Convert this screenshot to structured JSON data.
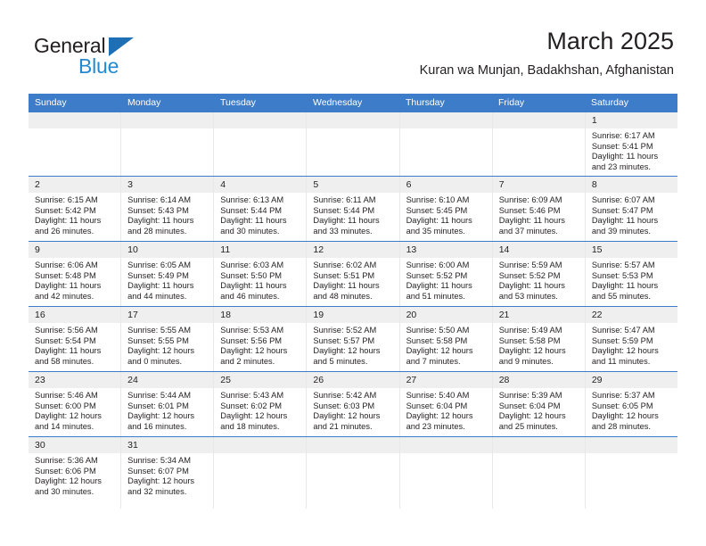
{
  "brand": {
    "name_top": "General",
    "name_bottom": "Blue",
    "accent_color": "#2389d1",
    "triangle_color": "#1f6fb5"
  },
  "header": {
    "month_title": "March 2025",
    "location": "Kuran wa Munjan, Badakhshan, Afghanistan"
  },
  "theme": {
    "header_blue": "#3d7cc9",
    "daynum_band": "#efefef",
    "text": "#231f20"
  },
  "weekdays": [
    "Sunday",
    "Monday",
    "Tuesday",
    "Wednesday",
    "Thursday",
    "Friday",
    "Saturday"
  ],
  "weeks": [
    {
      "days": [
        {
          "blank": true
        },
        {
          "blank": true
        },
        {
          "blank": true
        },
        {
          "blank": true
        },
        {
          "blank": true
        },
        {
          "blank": true
        },
        {
          "num": "1",
          "sunrise": "Sunrise: 6:17 AM",
          "sunset": "Sunset: 5:41 PM",
          "daylight_l1": "Daylight: 11 hours",
          "daylight_l2": "and 23 minutes."
        }
      ]
    },
    {
      "days": [
        {
          "num": "2",
          "sunrise": "Sunrise: 6:15 AM",
          "sunset": "Sunset: 5:42 PM",
          "daylight_l1": "Daylight: 11 hours",
          "daylight_l2": "and 26 minutes."
        },
        {
          "num": "3",
          "sunrise": "Sunrise: 6:14 AM",
          "sunset": "Sunset: 5:43 PM",
          "daylight_l1": "Daylight: 11 hours",
          "daylight_l2": "and 28 minutes."
        },
        {
          "num": "4",
          "sunrise": "Sunrise: 6:13 AM",
          "sunset": "Sunset: 5:44 PM",
          "daylight_l1": "Daylight: 11 hours",
          "daylight_l2": "and 30 minutes."
        },
        {
          "num": "5",
          "sunrise": "Sunrise: 6:11 AM",
          "sunset": "Sunset: 5:44 PM",
          "daylight_l1": "Daylight: 11 hours",
          "daylight_l2": "and 33 minutes."
        },
        {
          "num": "6",
          "sunrise": "Sunrise: 6:10 AM",
          "sunset": "Sunset: 5:45 PM",
          "daylight_l1": "Daylight: 11 hours",
          "daylight_l2": "and 35 minutes."
        },
        {
          "num": "7",
          "sunrise": "Sunrise: 6:09 AM",
          "sunset": "Sunset: 5:46 PM",
          "daylight_l1": "Daylight: 11 hours",
          "daylight_l2": "and 37 minutes."
        },
        {
          "num": "8",
          "sunrise": "Sunrise: 6:07 AM",
          "sunset": "Sunset: 5:47 PM",
          "daylight_l1": "Daylight: 11 hours",
          "daylight_l2": "and 39 minutes."
        }
      ]
    },
    {
      "days": [
        {
          "num": "9",
          "sunrise": "Sunrise: 6:06 AM",
          "sunset": "Sunset: 5:48 PM",
          "daylight_l1": "Daylight: 11 hours",
          "daylight_l2": "and 42 minutes."
        },
        {
          "num": "10",
          "sunrise": "Sunrise: 6:05 AM",
          "sunset": "Sunset: 5:49 PM",
          "daylight_l1": "Daylight: 11 hours",
          "daylight_l2": "and 44 minutes."
        },
        {
          "num": "11",
          "sunrise": "Sunrise: 6:03 AM",
          "sunset": "Sunset: 5:50 PM",
          "daylight_l1": "Daylight: 11 hours",
          "daylight_l2": "and 46 minutes."
        },
        {
          "num": "12",
          "sunrise": "Sunrise: 6:02 AM",
          "sunset": "Sunset: 5:51 PM",
          "daylight_l1": "Daylight: 11 hours",
          "daylight_l2": "and 48 minutes."
        },
        {
          "num": "13",
          "sunrise": "Sunrise: 6:00 AM",
          "sunset": "Sunset: 5:52 PM",
          "daylight_l1": "Daylight: 11 hours",
          "daylight_l2": "and 51 minutes."
        },
        {
          "num": "14",
          "sunrise": "Sunrise: 5:59 AM",
          "sunset": "Sunset: 5:52 PM",
          "daylight_l1": "Daylight: 11 hours",
          "daylight_l2": "and 53 minutes."
        },
        {
          "num": "15",
          "sunrise": "Sunrise: 5:57 AM",
          "sunset": "Sunset: 5:53 PM",
          "daylight_l1": "Daylight: 11 hours",
          "daylight_l2": "and 55 minutes."
        }
      ]
    },
    {
      "days": [
        {
          "num": "16",
          "sunrise": "Sunrise: 5:56 AM",
          "sunset": "Sunset: 5:54 PM",
          "daylight_l1": "Daylight: 11 hours",
          "daylight_l2": "and 58 minutes."
        },
        {
          "num": "17",
          "sunrise": "Sunrise: 5:55 AM",
          "sunset": "Sunset: 5:55 PM",
          "daylight_l1": "Daylight: 12 hours",
          "daylight_l2": "and 0 minutes."
        },
        {
          "num": "18",
          "sunrise": "Sunrise: 5:53 AM",
          "sunset": "Sunset: 5:56 PM",
          "daylight_l1": "Daylight: 12 hours",
          "daylight_l2": "and 2 minutes."
        },
        {
          "num": "19",
          "sunrise": "Sunrise: 5:52 AM",
          "sunset": "Sunset: 5:57 PM",
          "daylight_l1": "Daylight: 12 hours",
          "daylight_l2": "and 5 minutes."
        },
        {
          "num": "20",
          "sunrise": "Sunrise: 5:50 AM",
          "sunset": "Sunset: 5:58 PM",
          "daylight_l1": "Daylight: 12 hours",
          "daylight_l2": "and 7 minutes."
        },
        {
          "num": "21",
          "sunrise": "Sunrise: 5:49 AM",
          "sunset": "Sunset: 5:58 PM",
          "daylight_l1": "Daylight: 12 hours",
          "daylight_l2": "and 9 minutes."
        },
        {
          "num": "22",
          "sunrise": "Sunrise: 5:47 AM",
          "sunset": "Sunset: 5:59 PM",
          "daylight_l1": "Daylight: 12 hours",
          "daylight_l2": "and 11 minutes."
        }
      ]
    },
    {
      "days": [
        {
          "num": "23",
          "sunrise": "Sunrise: 5:46 AM",
          "sunset": "Sunset: 6:00 PM",
          "daylight_l1": "Daylight: 12 hours",
          "daylight_l2": "and 14 minutes."
        },
        {
          "num": "24",
          "sunrise": "Sunrise: 5:44 AM",
          "sunset": "Sunset: 6:01 PM",
          "daylight_l1": "Daylight: 12 hours",
          "daylight_l2": "and 16 minutes."
        },
        {
          "num": "25",
          "sunrise": "Sunrise: 5:43 AM",
          "sunset": "Sunset: 6:02 PM",
          "daylight_l1": "Daylight: 12 hours",
          "daylight_l2": "and 18 minutes."
        },
        {
          "num": "26",
          "sunrise": "Sunrise: 5:42 AM",
          "sunset": "Sunset: 6:03 PM",
          "daylight_l1": "Daylight: 12 hours",
          "daylight_l2": "and 21 minutes."
        },
        {
          "num": "27",
          "sunrise": "Sunrise: 5:40 AM",
          "sunset": "Sunset: 6:04 PM",
          "daylight_l1": "Daylight: 12 hours",
          "daylight_l2": "and 23 minutes."
        },
        {
          "num": "28",
          "sunrise": "Sunrise: 5:39 AM",
          "sunset": "Sunset: 6:04 PM",
          "daylight_l1": "Daylight: 12 hours",
          "daylight_l2": "and 25 minutes."
        },
        {
          "num": "29",
          "sunrise": "Sunrise: 5:37 AM",
          "sunset": "Sunset: 6:05 PM",
          "daylight_l1": "Daylight: 12 hours",
          "daylight_l2": "and 28 minutes."
        }
      ]
    },
    {
      "days": [
        {
          "num": "30",
          "sunrise": "Sunrise: 5:36 AM",
          "sunset": "Sunset: 6:06 PM",
          "daylight_l1": "Daylight: 12 hours",
          "daylight_l2": "and 30 minutes."
        },
        {
          "num": "31",
          "sunrise": "Sunrise: 5:34 AM",
          "sunset": "Sunset: 6:07 PM",
          "daylight_l1": "Daylight: 12 hours",
          "daylight_l2": "and 32 minutes."
        },
        {
          "blank": true
        },
        {
          "blank": true
        },
        {
          "blank": true
        },
        {
          "blank": true
        },
        {
          "blank": true
        }
      ]
    }
  ]
}
